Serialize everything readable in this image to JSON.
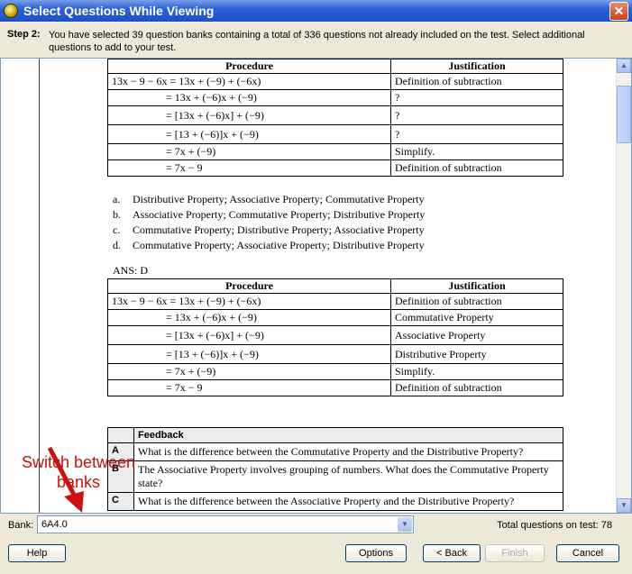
{
  "window": {
    "title": "Select Questions While Viewing",
    "close_glyph": "✕"
  },
  "step": {
    "label": "Step 2:",
    "text": "You have selected 39 question banks containing a total of 336 questions not already included on the test. Select additional questions to add to your test."
  },
  "question_table": {
    "headers": [
      "Procedure",
      "Justification"
    ],
    "rows": [
      {
        "proc": "13x − 9 − 6x = 13x + (−9) + (−6x)",
        "just": "Definition of subtraction"
      },
      {
        "proc": "= 13x + (−6)x + (−9)",
        "just": "?"
      },
      {
        "proc": "= [13x + (−6)x] + (−9)",
        "just": "?"
      },
      {
        "proc": "= [13 + (−6)]x + (−9)",
        "just": "?"
      },
      {
        "proc": "= 7x + (−9)",
        "just": "Simplify."
      },
      {
        "proc": "= 7x − 9",
        "just": "Definition of subtraction"
      }
    ]
  },
  "options": [
    {
      "key": "a.",
      "text": "Distributive Property; Associative Property; Commutative Property"
    },
    {
      "key": "b.",
      "text": "Associative Property; Commutative Property; Distributive Property"
    },
    {
      "key": "c.",
      "text": "Commutative Property; Distributive Property; Associative Property"
    },
    {
      "key": "d.",
      "text": "Commutative Property; Associative Property; Distributive Property"
    }
  ],
  "answer": "ANS: D",
  "answer_table": {
    "headers": [
      "Procedure",
      "Justification"
    ],
    "rows": [
      {
        "proc": "13x − 9 − 6x = 13x + (−9) + (−6x)",
        "just": "Definition of subtraction"
      },
      {
        "proc": "= 13x + (−6)x + (−9)",
        "just": "Commutative Property"
      },
      {
        "proc": "= [13x + (−6)x] + (−9)",
        "just": "Associative Property"
      },
      {
        "proc": "= [13 + (−6)]x + (−9)",
        "just": "Distributive Property"
      },
      {
        "proc": "= 7x + (−9)",
        "just": "Simplify."
      },
      {
        "proc": "= 7x − 9",
        "just": "Definition of subtraction"
      }
    ]
  },
  "feedback": {
    "header": "Feedback",
    "rows": [
      {
        "key": "A",
        "text": "What is the difference between the Commutative Property and the Distributive Property?"
      },
      {
        "key": "B",
        "text": "The Associative Property involves grouping of numbers. What does the Commutative Property state?"
      },
      {
        "key": "C",
        "text": "What is the difference between the Associative Property and the Distributive Property?"
      }
    ]
  },
  "annotation": {
    "line1": "Switch between",
    "line2": "banks",
    "color": "#cc1010"
  },
  "bottom": {
    "bank_label": "Bank:",
    "bank_value": "6A4.0",
    "total_label": "Total questions on test:",
    "total_value": "78",
    "buttons": {
      "help": "Help",
      "options": "Options",
      "back": "< Back",
      "finish": "Finish",
      "cancel": "Cancel"
    }
  }
}
